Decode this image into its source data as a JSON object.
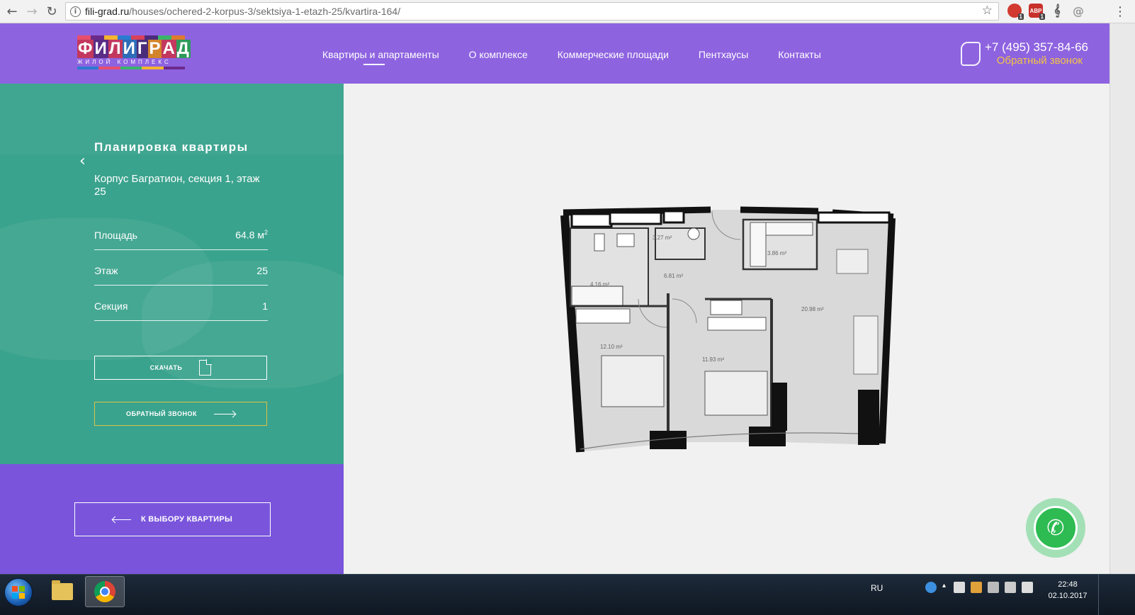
{
  "browser": {
    "url_domain": "fili-grad.ru",
    "url_path": "/houses/ochered-2-korpus-3/sektsiya-1-etazh-25/kvartira-164/",
    "ext_badge_1": "1",
    "ext_badge_2": "1",
    "ext_abp_label": "ABP"
  },
  "header": {
    "logo_text": [
      "Ф",
      "И",
      "Л",
      "И",
      "Г",
      "Р",
      "А",
      "Д"
    ],
    "logo_subtitle": "ЖИЛОЙ КОМПЛЕКС",
    "nav": [
      {
        "label": "Квартиры и апартаменты",
        "active": true
      },
      {
        "label": "О комплексе"
      },
      {
        "label": "Коммерческие площади"
      },
      {
        "label": "Пентхаусы"
      },
      {
        "label": "Контакты"
      }
    ],
    "phone": "+7 (495) 357-84-66",
    "callback": "Обратный звонок"
  },
  "panel": {
    "title": "Планировка квартиры",
    "subtitle": "Корпус Багратион, секция 1, этаж 25",
    "specs": [
      {
        "label": "Площадь",
        "value": "64.8 м",
        "unit_sup": "2"
      },
      {
        "label": "Этаж",
        "value": "25"
      },
      {
        "label": "Секция",
        "value": "1"
      }
    ],
    "download_label": "СКАЧАТЬ",
    "callback_label": "ОБРАТНЫЙ ЗВОНОК",
    "back_label": "К ВЫБОРУ КВАРТИРЫ"
  },
  "plan": {
    "rooms": [
      "3.27 m²",
      "3.86 m²",
      "6.81 m²",
      "4.16 m²",
      "20.98 m²",
      "12.10 m²",
      "11.93 m²"
    ]
  },
  "taskbar": {
    "language": "RU",
    "time": "22:48",
    "date": "02.10.2017"
  },
  "colors": {
    "header_purple": "#8e63e0",
    "panel_teal": "#3aa38d",
    "bottom_purple": "#7a55dc",
    "callback_yellow": "#f3c443",
    "call_widget_green": "#2dbb52"
  }
}
